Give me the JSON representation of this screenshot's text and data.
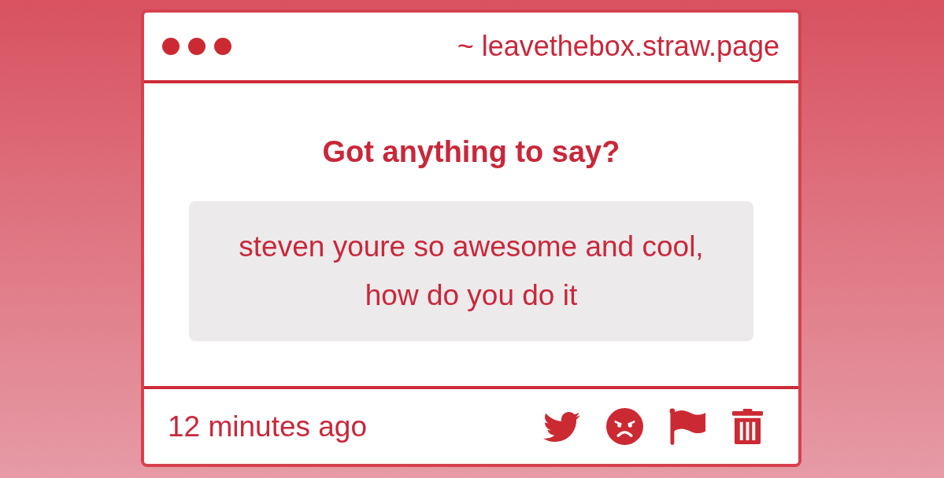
{
  "window": {
    "url": "~ leavethebox.straw.page"
  },
  "prompt": {
    "title": "Got anything to say?"
  },
  "message": {
    "text": "steven youre so awesome and cool, how do you do it"
  },
  "footer": {
    "time": "12 minutes ago"
  }
}
